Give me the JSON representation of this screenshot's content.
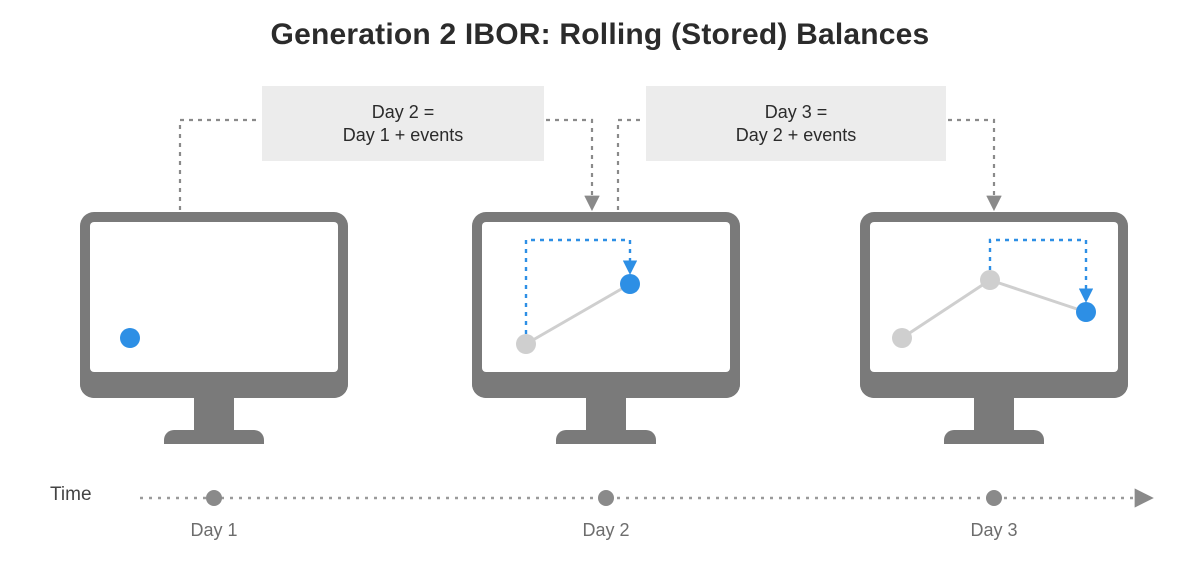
{
  "title": "Generation 2 IBOR: Rolling (Stored) Balances",
  "callouts": {
    "c1_line1": "Day 2 =",
    "c1_line2": "Day 1 + events",
    "c2_line1": "Day 3 =",
    "c2_line2": "Day 2 + events"
  },
  "timeline": {
    "axis_label": "Time",
    "day1": "Day 1",
    "day2": "Day 2",
    "day3": "Day 3"
  },
  "colors": {
    "blue": "#2d8fe5",
    "grey": "#7a7a7a",
    "light_grey": "#bdbdbd"
  }
}
